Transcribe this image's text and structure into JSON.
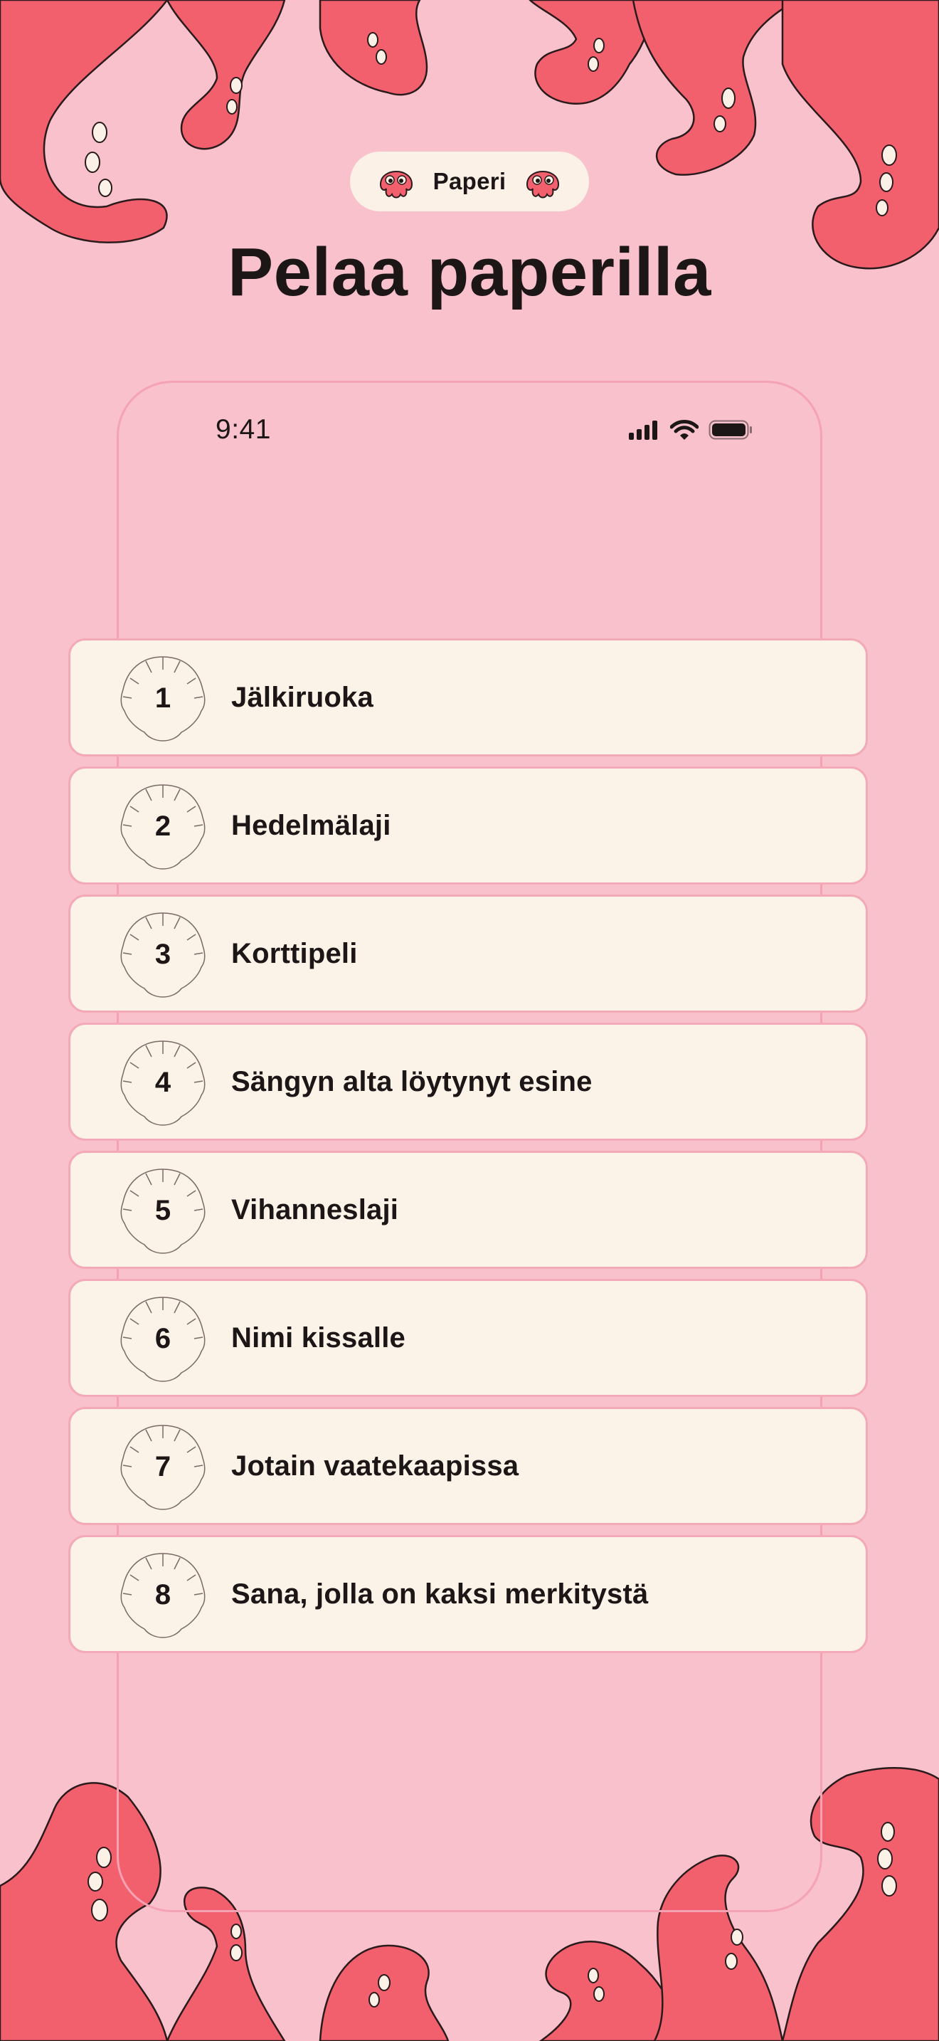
{
  "colors": {
    "background": "#f8c1cc",
    "tentacle": "#f2606e",
    "card": "#fbf2e8",
    "card_border": "#f3a9b8",
    "text": "#1c1617"
  },
  "badge": {
    "label": "Paperi",
    "icon": "octopus-icon"
  },
  "title": "Pelaa paperilla",
  "status_bar": {
    "time": "9:41",
    "icons": [
      "signal-icon",
      "wifi-icon",
      "battery-icon"
    ]
  },
  "prompts": [
    {
      "number": "1",
      "label": "Jälkiruoka"
    },
    {
      "number": "2",
      "label": "Hedelmälaji"
    },
    {
      "number": "3",
      "label": "Korttipeli"
    },
    {
      "number": "4",
      "label": "Sängyn alta löytynyt esine"
    },
    {
      "number": "5",
      "label": "Vihanneslaji"
    },
    {
      "number": "6",
      "label": "Nimi kissalle"
    },
    {
      "number": "7",
      "label": "Jotain vaatekaapissa"
    },
    {
      "number": "8",
      "label": "Sana, jolla on kaksi merkitystä"
    }
  ]
}
